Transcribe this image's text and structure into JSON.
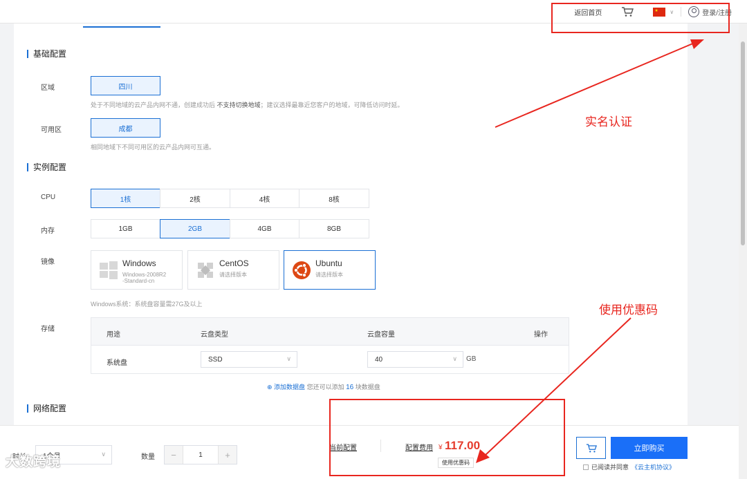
{
  "header": {
    "home_link": "返回首页",
    "login_link": "登录/注册"
  },
  "basic": {
    "title": "基础配置",
    "region_label": "区域",
    "region_value": "四川",
    "region_hint_a": "处于不同地域的云产品内网不通，创建成功后",
    "region_hint_b": "不支持切换地域",
    "region_hint_c": "；建议选择最靠近您客户的地域，可降低访问时延。",
    "zone_label": "可用区",
    "zone_value": "成都",
    "zone_hint": "相同地域下不同可用区的云产品内网可互通。"
  },
  "instance": {
    "title": "实例配置",
    "cpu_label": "CPU",
    "cpu_options": [
      "1核",
      "2核",
      "4核",
      "8核"
    ],
    "cpu_selected": "1核",
    "mem_label": "内存",
    "mem_options": [
      "1GB",
      "2GB",
      "4GB",
      "8GB"
    ],
    "mem_selected": "2GB",
    "image_label": "镜像",
    "images": [
      {
        "name": "Windows",
        "sub1": "Windows-2008R2",
        "sub2": "-Standard-cn",
        "icon": "windows-icon"
      },
      {
        "name": "CentOS",
        "sub1": "请选择版本",
        "sub2": "",
        "icon": "centos-icon"
      },
      {
        "name": "Ubuntu",
        "sub1": "请选择版本",
        "sub2": "",
        "icon": "ubuntu-icon"
      }
    ],
    "image_selected": "Ubuntu",
    "image_hint": "Windows系统：系统盘容量需27G及以上"
  },
  "storage": {
    "label": "存储",
    "headers": [
      "用途",
      "云盘类型",
      "云盘容量",
      "操作"
    ],
    "row": {
      "usage": "系统盘",
      "type": "SSD",
      "size": "40",
      "unit": "GB"
    },
    "add_disk": "添加数据盘",
    "add_hint_pre": "您还可以添加",
    "add_count": "16",
    "add_hint_post": "块数据盘"
  },
  "network": {
    "title": "网络配置"
  },
  "footer": {
    "duration_label": "时长",
    "duration_value": "1个月",
    "qty_label": "数量",
    "qty_minus": "−",
    "qty_value": "1",
    "qty_plus": "+",
    "current_config": "当前配置",
    "fee_label": "配置费用",
    "currency": "¥",
    "price": "117.00",
    "coupon_button": "使用优惠码",
    "buy_button": "立即购买",
    "agree_text": "已阅读并同意",
    "agreement_link": "《云主机协议》"
  },
  "annotations": {
    "top_note": "实名认证",
    "coupon_note": "使用优惠码",
    "color": "#e8261f"
  },
  "watermark": "大数跨境",
  "colors": {
    "accent": "#1a6fd4",
    "price": "#e53b2c"
  }
}
